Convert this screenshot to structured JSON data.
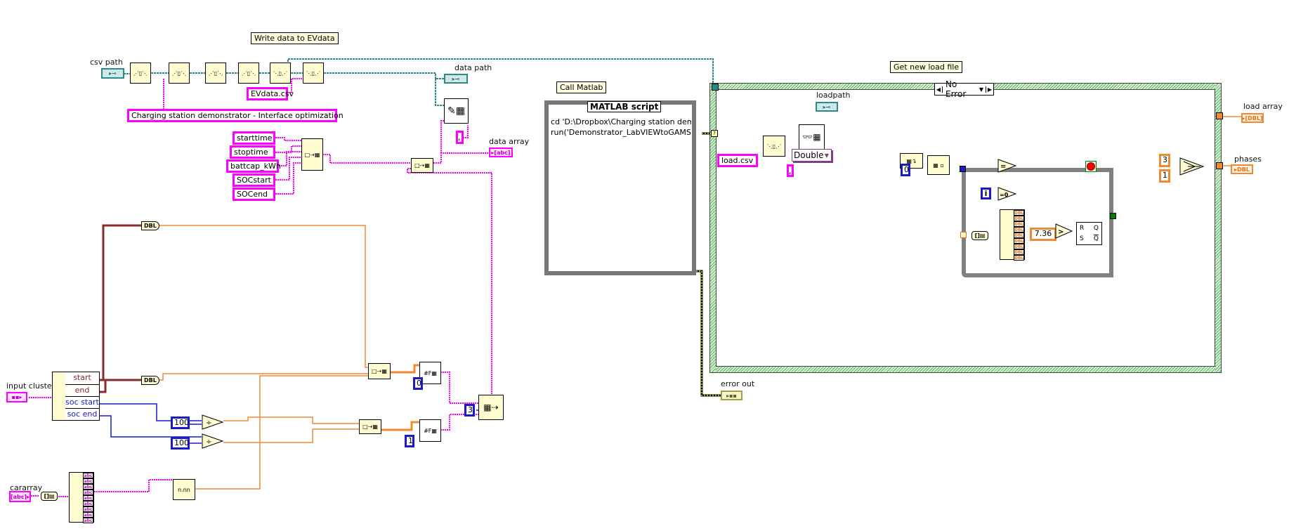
{
  "labels": {
    "write_data": "Write data to EVdata",
    "call_matlab": "Call Matlab",
    "get_new_load_file": "Get new load file"
  },
  "controls": {
    "csv_path": "csv path",
    "input_cluster": "input cluster",
    "cararray": "cararray"
  },
  "indicators": {
    "data_path": "data path",
    "data_array": "data array",
    "loadpath": "loadpath",
    "load_array": "load array",
    "phases": "phases",
    "error_out": "error out"
  },
  "constants": {
    "evdata_csv": "EVdata.csv",
    "header_text": "Charging station demonstrator - Interface optimization",
    "starttime": "starttime",
    "stoptime": "stoptime",
    "battcap": "battcap_kWh",
    "socstart": "SOCstart",
    "socend": "SOCend",
    "delimiter": ",",
    "hundred_a": "100",
    "hundred_b": "100",
    "zero_a": "0",
    "one_a": "1",
    "three_a": "3",
    "load_csv": "load.csv",
    "load_delim": ",",
    "zero_b": "0",
    "threshold": "7.36",
    "three_b": "3",
    "one_b": "1",
    "iter": "i"
  },
  "unbundle": {
    "fields": [
      "start",
      "end",
      "soc start",
      "soc end"
    ]
  },
  "conversions": {
    "dbl_top": "DBL",
    "dbl_bottom": "DBL"
  },
  "matlab": {
    "title": "MATLAB script",
    "lines": [
      "cd 'D:\\Dropbox\\Charging station dem",
      "run('Demonstrator_LabVIEWtoGAMS')"
    ]
  },
  "case_structure": {
    "selector": "No Error"
  },
  "read_spreadsheet": {
    "type": "Double"
  },
  "terminal_types": {
    "path": "path",
    "string": "abc",
    "dbl": "DBL",
    "cluster": "cluster",
    "error": "error"
  },
  "colors": {
    "path_wire": "#2a8a8a",
    "string_wire": "#ff00ff",
    "dbl_wire": "#f08a30",
    "int_wire": "#1a1ac8",
    "cluster_wire": "#8b2b2b",
    "bool_wire": "#008000",
    "error_wire": "#c8c800",
    "node_bg": "#fffcd0",
    "case_border": "#8fd08f",
    "loop_border": "#808080"
  }
}
